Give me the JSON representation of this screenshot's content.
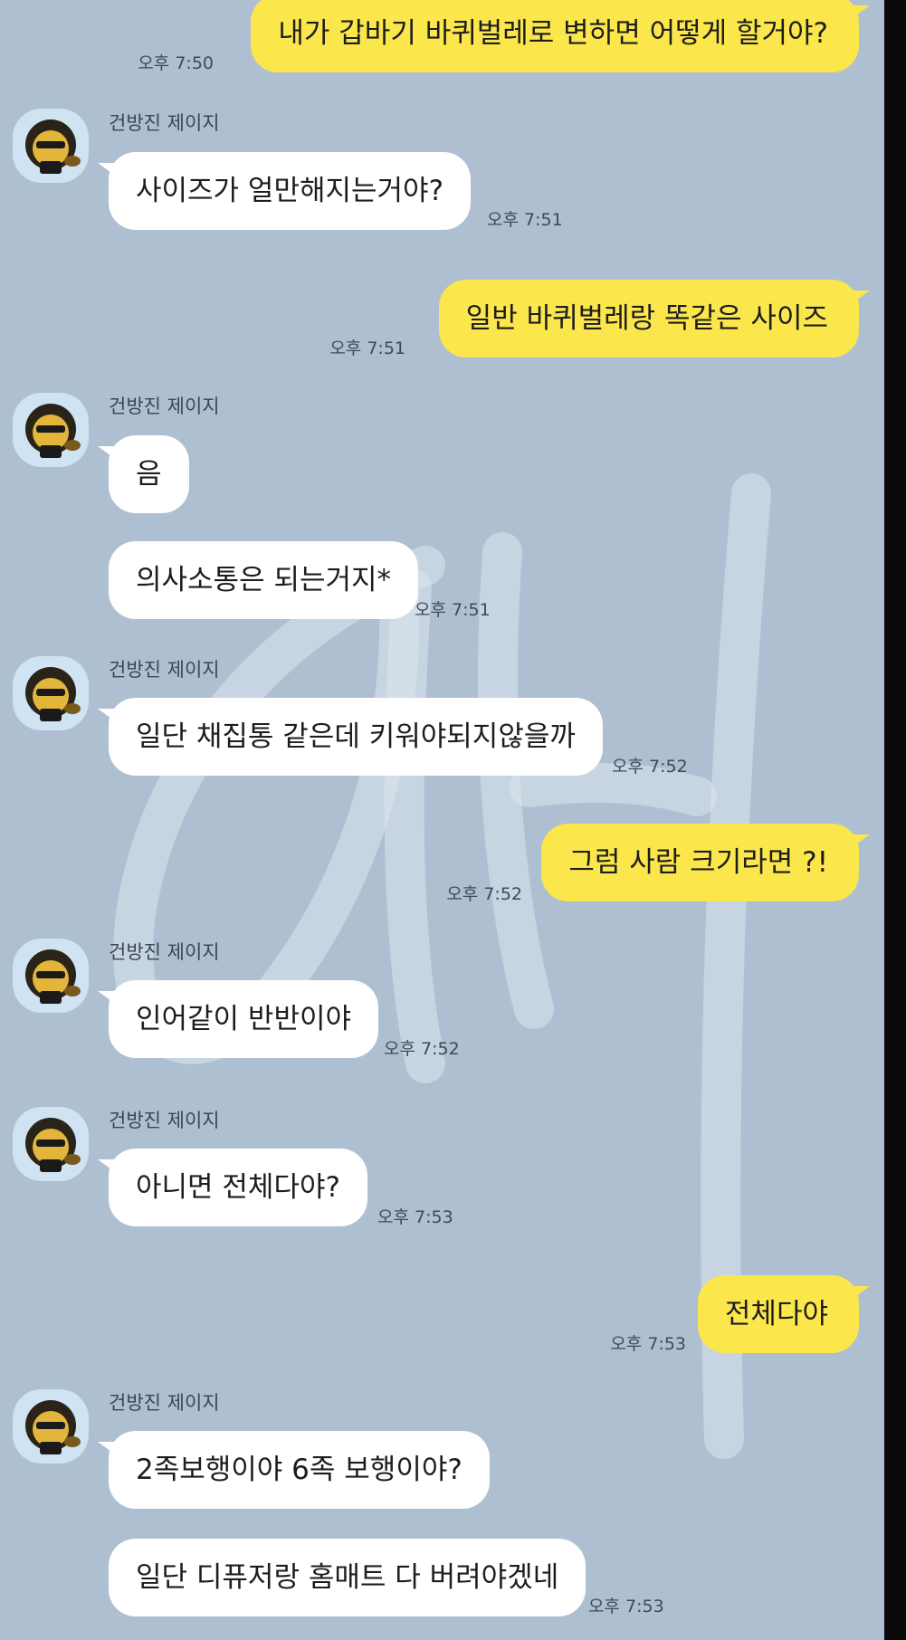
{
  "watermark_text": "예",
  "messages": [
    {
      "side": "mine",
      "text": "내가 갑바기 바퀴벌레로 변하면 어떻게 할거야?",
      "time": "오후 7:50"
    },
    {
      "side": "other",
      "sender": "건방진 제이지",
      "text": "사이즈가 얼만해지는거야?",
      "time": "오후 7:51"
    },
    {
      "side": "mine",
      "text": "일반 바퀴벌레랑 똑같은 사이즈",
      "time": "오후 7:51"
    },
    {
      "side": "other",
      "sender": "건방진 제이지",
      "text": "음"
    },
    {
      "side": "other",
      "text": "의사소통은 되는거지*",
      "time": "오후 7:51"
    },
    {
      "side": "other",
      "sender": "건방진 제이지",
      "text": "일단 채집통 같은데 키워야되지않을까",
      "time": "오후 7:52"
    },
    {
      "side": "mine",
      "text": "그럼 사람 크기라면 ?!",
      "time": "오후 7:52"
    },
    {
      "side": "other",
      "sender": "건방진 제이지",
      "text": "인어같이 반반이야",
      "time": "오후 7:52"
    },
    {
      "side": "other",
      "sender": "건방진 제이지",
      "text": "아니면 전체다야?",
      "time": "오후 7:53"
    },
    {
      "side": "mine",
      "text": "전체다야",
      "time": "오후 7:53"
    },
    {
      "side": "other",
      "sender": "건방진 제이지",
      "text": "2족보행이야 6족 보행이야?"
    },
    {
      "side": "other",
      "text": "일단 디퓨저랑 홈매트 다 버려야겠네",
      "time": "오후 7:53"
    }
  ],
  "colors": {
    "background": "#aebfd1",
    "my_bubble": "#fbe74c",
    "other_bubble": "#ffffff"
  }
}
